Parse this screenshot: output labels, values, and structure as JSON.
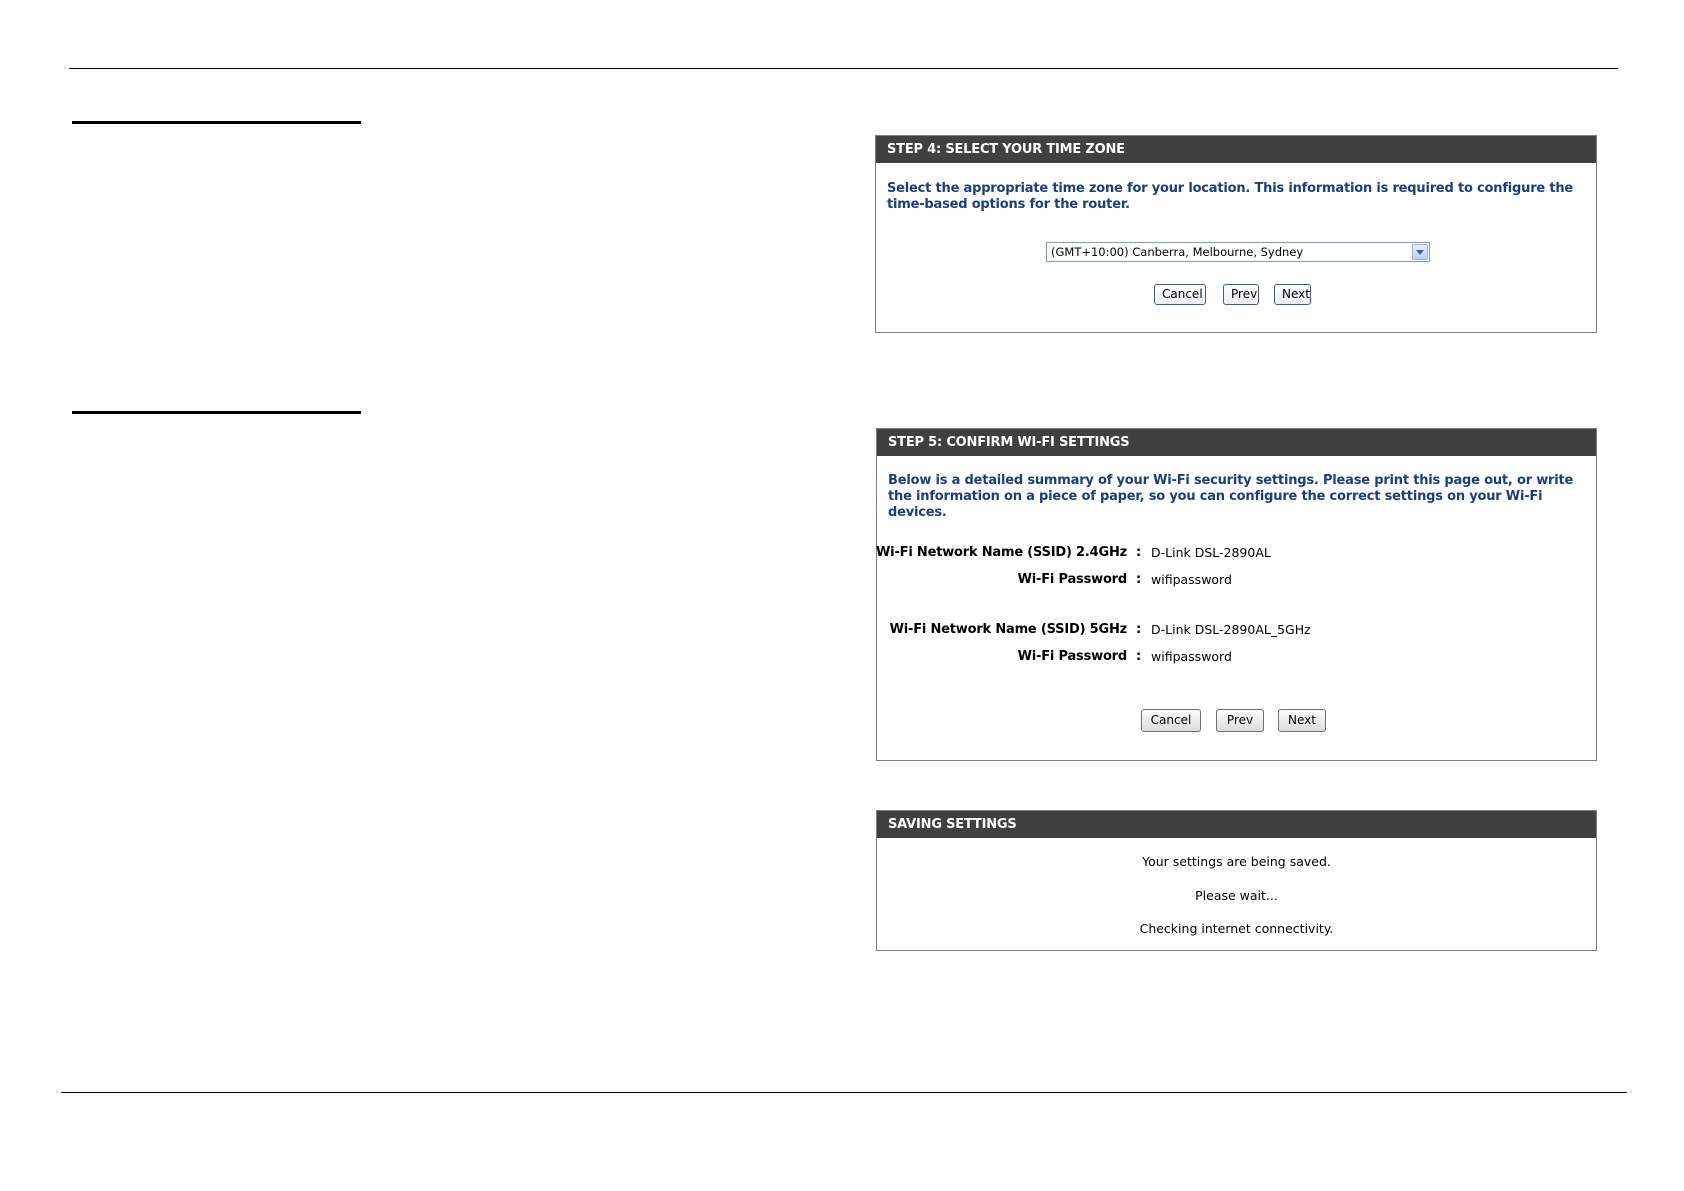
{
  "step4": {
    "header": "STEP 4: SELECT YOUR TIME ZONE",
    "intro": "Select the appropriate time zone for your location. This information is required to configure the time-based options for the router.",
    "timezone_selected": "(GMT+10:00) Canberra, Melbourne, Sydney",
    "cancel_label": "Cancel",
    "prev_label": "Prev",
    "next_label": "Next"
  },
  "step5": {
    "header": "STEP 5: CONFIRM WI-FI SETTINGS",
    "intro": "Below is a detailed summary of your Wi-Fi security settings. Please print this page out, or write the information on a piece of paper, so you can configure the correct settings on your Wi-Fi devices.",
    "rows": [
      {
        "label": "Wi-Fi Network Name (SSID) 2.4GHz",
        "value": "D-Link DSL-2890AL"
      },
      {
        "label": "Wi-Fi Password",
        "value": "wifipassword"
      },
      {
        "label": "Wi-Fi Network Name (SSID) 5GHz",
        "value": "D-Link DSL-2890AL_5GHz"
      },
      {
        "label": "Wi-Fi Password",
        "value": "wifipassword"
      }
    ],
    "separator": ":",
    "cancel_label": "Cancel",
    "prev_label": "Prev",
    "next_label": "Next"
  },
  "saving": {
    "header": "SAVING SETTINGS",
    "lines": [
      "Your settings are being saved.",
      "Please wait...",
      "Checking internet connectivity."
    ]
  }
}
